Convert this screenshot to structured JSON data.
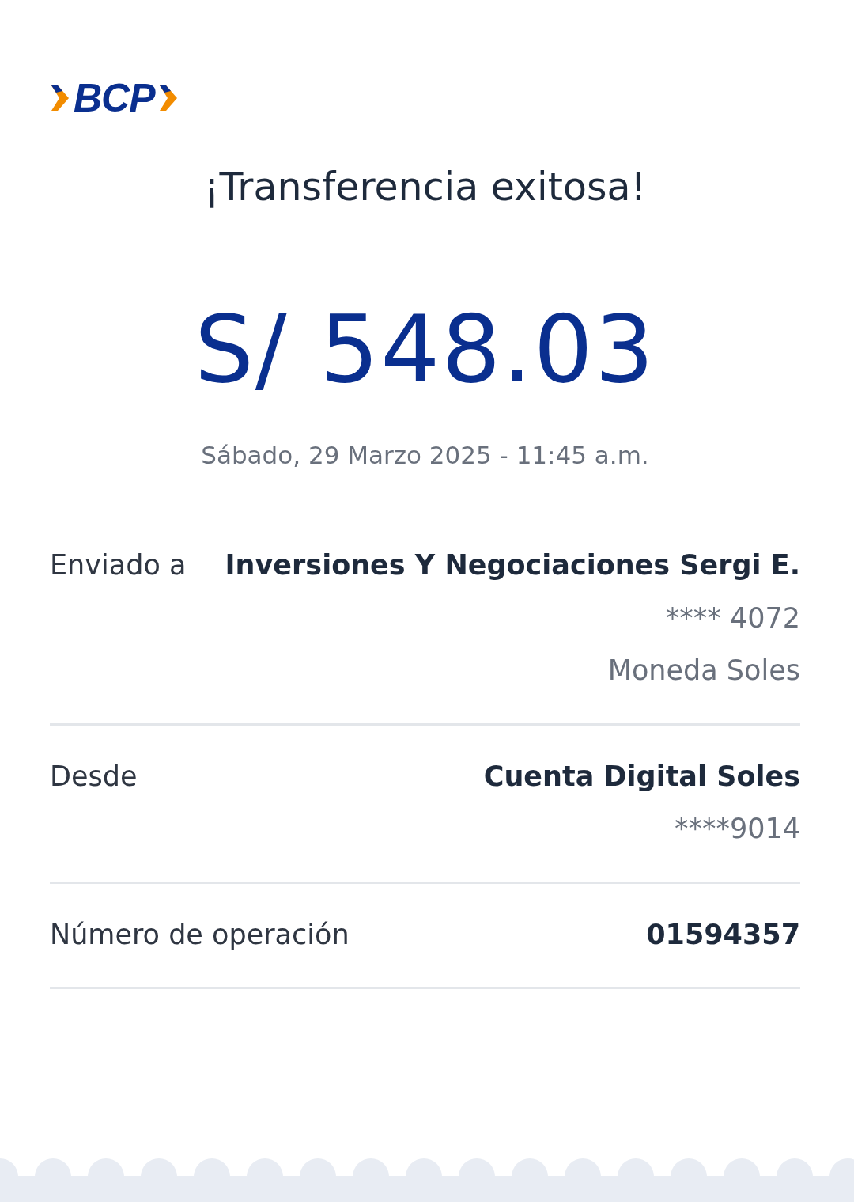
{
  "logo": {
    "text": "BCP"
  },
  "title": "¡Transferencia exitosa!",
  "amount": "S/ 548.03",
  "datetime": "Sábado, 29 Marzo 2025 - 11:45 a.m.",
  "details": [
    {
      "label": "Enviado a",
      "value": "Inversiones Y Negociaciones Sergi E.",
      "sublines": [
        "**** 4072",
        "Moneda Soles"
      ]
    },
    {
      "label": "Desde",
      "value": "Cuenta Digital Soles",
      "sublines": [
        "****9014"
      ]
    },
    {
      "label": "Número de operación",
      "value": "01594357"
    }
  ]
}
